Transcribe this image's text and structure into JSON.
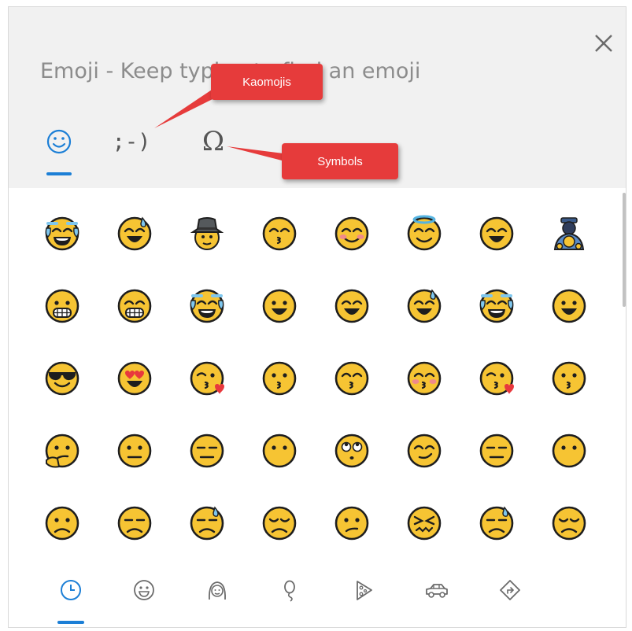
{
  "header": {
    "title": "Emoji - Keep typing to find an emoji",
    "close_label": "×"
  },
  "mode_tabs": [
    {
      "name": "emoji",
      "label": "☺",
      "active": true
    },
    {
      "name": "kaomoji",
      "label": ";-)",
      "active": false
    },
    {
      "name": "symbols",
      "label": "Ω",
      "active": false
    }
  ],
  "callouts": {
    "kaomojis": "Kaomojis",
    "symbols": "Symbols"
  },
  "emoji_grid": [
    [
      "tears-of-joy",
      "grinning-sweat",
      "detective",
      "kissing-smiling-eyes",
      "blushing",
      "angel",
      "smiling-eyes",
      "person-bowing"
    ],
    [
      "grimacing",
      "grinning-teeth",
      "tears-of-joy",
      "open-mouth-smile",
      "big-smile",
      "grinning-sweat",
      "tears-of-joy",
      "grinning"
    ],
    [
      "sunglasses",
      "heart-eyes",
      "kissing-heart",
      "kissing",
      "kissing-smiling-eyes",
      "kissing-blush",
      "kissing-heart",
      "kissing"
    ],
    [
      "thinking",
      "neutral",
      "expressionless",
      "no-mouth",
      "rolling-eyes",
      "smirk",
      "expressionless",
      "no-mouth"
    ],
    [
      "slightly-frowning",
      "unamused",
      "downcast-sweat",
      "pensive",
      "confused",
      "confounded",
      "downcast-sweat",
      "pensive"
    ]
  ],
  "categories": [
    {
      "icon": "clock-icon",
      "active": true
    },
    {
      "icon": "smiley-icon",
      "active": false
    },
    {
      "icon": "person-icon",
      "active": false
    },
    {
      "icon": "balloon-icon",
      "active": false
    },
    {
      "icon": "pizza-icon",
      "active": false
    },
    {
      "icon": "car-icon",
      "active": false
    },
    {
      "icon": "road-sign-icon",
      "active": false
    }
  ],
  "colors": {
    "accent": "#1c7fd6",
    "emoji_face": "#f6c433",
    "callout": "#e63b3b"
  }
}
